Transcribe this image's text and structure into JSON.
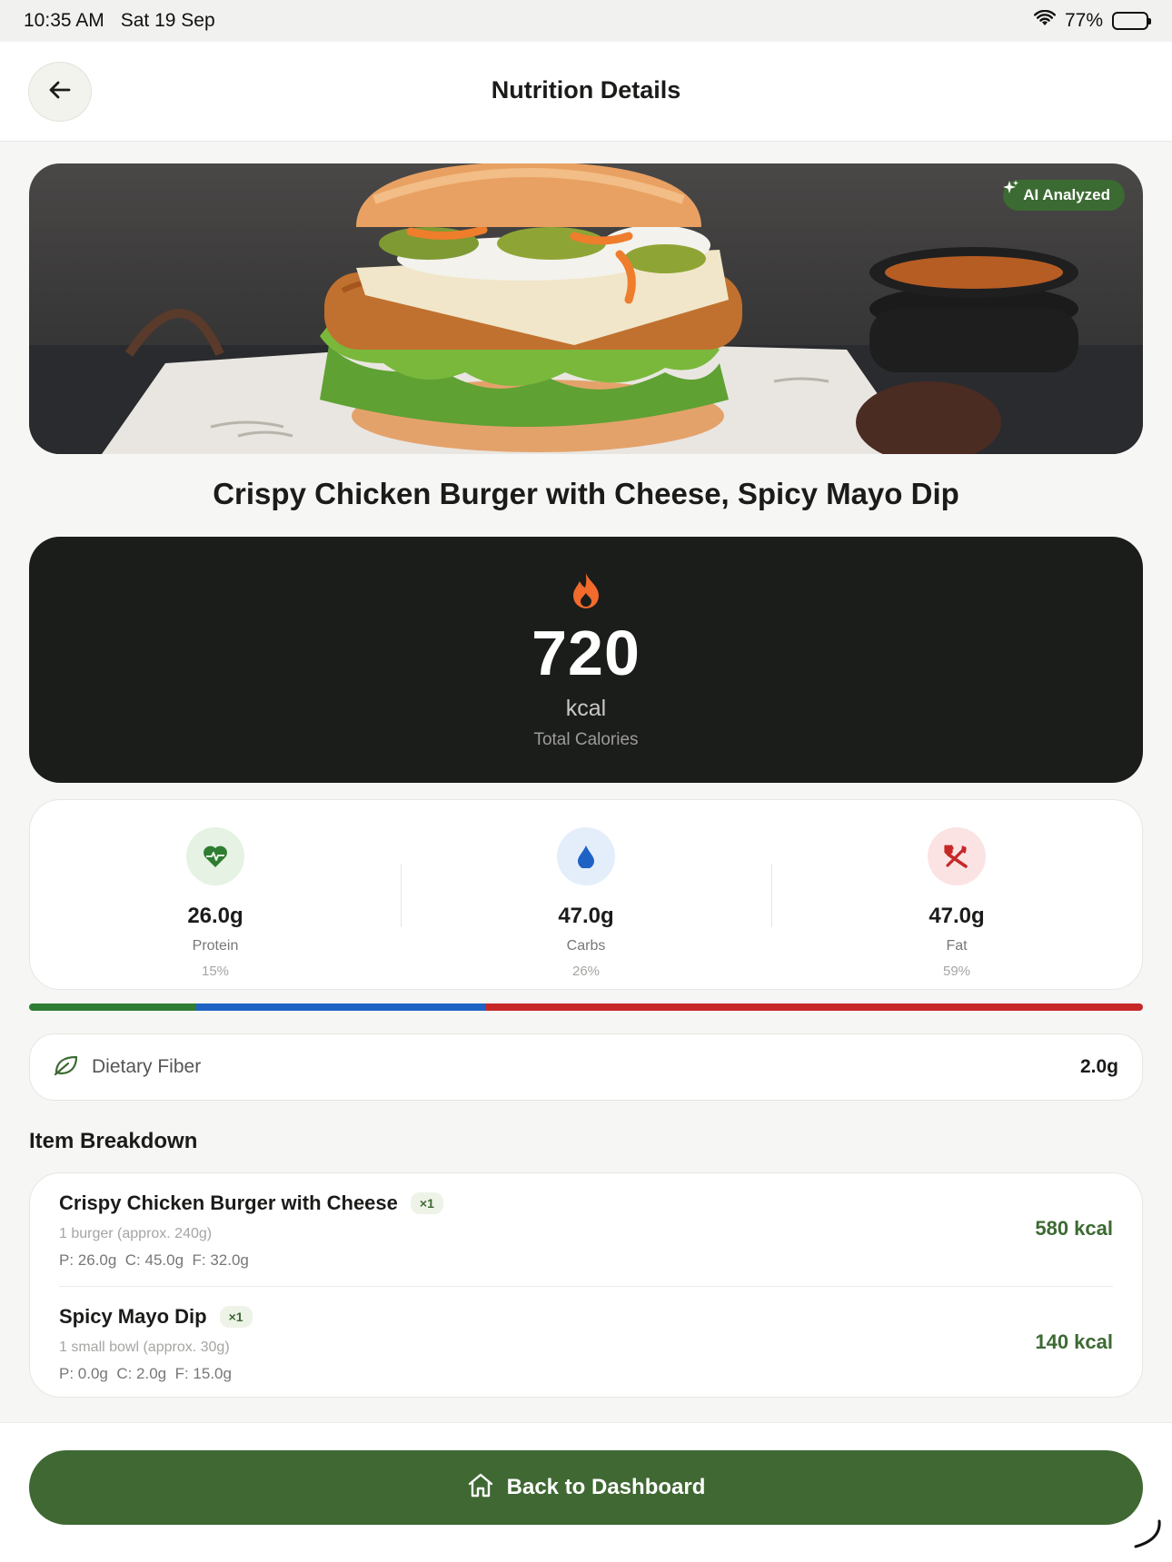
{
  "status_bar": {
    "time": "10:35 AM",
    "date": "Sat 19 Sep",
    "battery": "77%",
    "battery_level": 0.77
  },
  "header": {
    "title": "Nutrition Details",
    "back_icon": "arrow-left-icon"
  },
  "hero": {
    "badge": "AI Analyzed",
    "badge_icon": "sparkle-icon"
  },
  "meal": {
    "title": "Crispy Chicken Burger with Cheese, Spicy Mayo Dip"
  },
  "calories": {
    "value": "720",
    "unit": "kcal",
    "label": "Total Calories",
    "icon": "flame-icon",
    "icon_color": "#f26b2d"
  },
  "macros": [
    {
      "value": "26.0g",
      "label": "Protein",
      "percent": "15%",
      "share": 0.15,
      "icon": "heartbeat-icon",
      "color": "#2e7d32",
      "bg": "#e6f2e4"
    },
    {
      "value": "47.0g",
      "label": "Carbs",
      "percent": "26%",
      "share": 0.26,
      "icon": "water-drop-icon",
      "color": "#1e63c4",
      "bg": "#e4eefb"
    },
    {
      "value": "47.0g",
      "label": "Fat",
      "percent": "59%",
      "share": 0.59,
      "icon": "utensils-icon",
      "color": "#c62828",
      "bg": "#fbe3e3"
    }
  ],
  "fiber": {
    "label": "Dietary Fiber",
    "value": "2.0g",
    "icon": "leaf-icon"
  },
  "breakdown": {
    "title": "Item Breakdown",
    "items": [
      {
        "name": "Crispy Chicken Burger with Cheese",
        "qty": "×1",
        "portion": "1 burger (approx. 240g)",
        "macros": "P: 26.0g  C: 45.0g  F: 32.0g",
        "kcal": "580 kcal"
      },
      {
        "name": "Spicy Mayo Dip",
        "qty": "×1",
        "portion": "1 small bowl (approx. 30g)",
        "macros": "P: 0.0g  C: 2.0g  F: 15.0g",
        "kcal": "140 kcal"
      }
    ]
  },
  "footer": {
    "button_label": "Back to Dashboard",
    "button_icon": "home-icon",
    "accent": "#3f6833"
  }
}
